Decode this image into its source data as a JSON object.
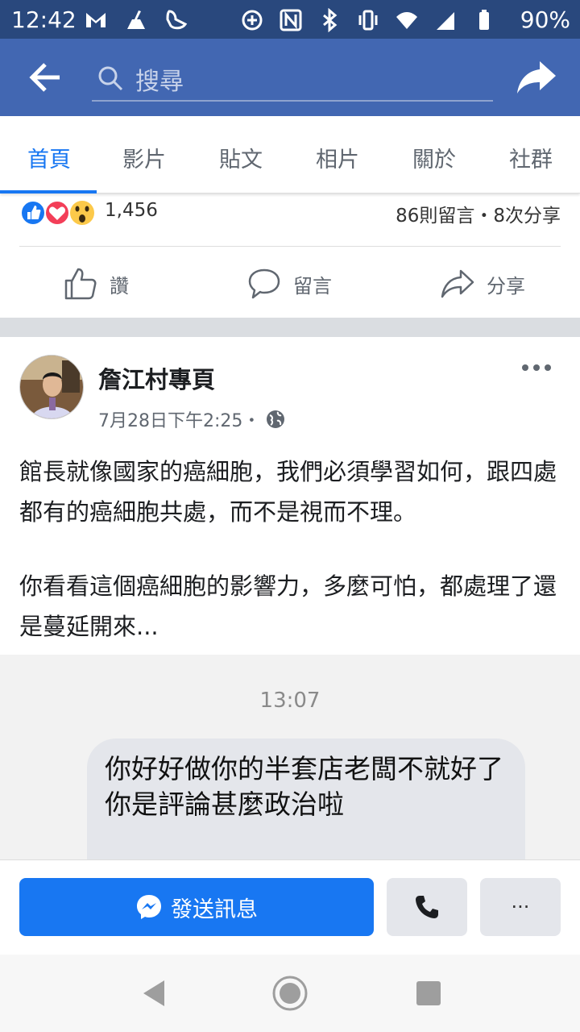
{
  "status_bar": {
    "time": "12:42",
    "battery": "90%",
    "left_icons": [
      "gmail-icon",
      "cleaner-icon",
      "pigeon-icon"
    ],
    "right_icons": [
      "add-circle-icon",
      "nfc-icon",
      "bluetooth-icon",
      "vibrate-icon",
      "wifi-icon",
      "signal-icon",
      "battery-icon"
    ]
  },
  "header": {
    "search_placeholder": "搜尋"
  },
  "tabs": [
    {
      "label": "首頁",
      "active": true
    },
    {
      "label": "影片",
      "active": false
    },
    {
      "label": "貼文",
      "active": false
    },
    {
      "label": "相片",
      "active": false
    },
    {
      "label": "關於",
      "active": false
    },
    {
      "label": "社群",
      "active": false
    }
  ],
  "reactions": {
    "icons": [
      "like-icon",
      "love-icon",
      "wow-icon"
    ],
    "count": "1,456",
    "summary": "86則留言・8次分享"
  },
  "actions": {
    "like": "讚",
    "comment": "留言",
    "share": "分享"
  },
  "post": {
    "author": "詹江村專頁",
    "time": "7月28日下午2:25・",
    "privacy_icon": "globe-icon",
    "paragraph1": "館長就像國家的癌細胞，我們必須學習如何，跟四處都有的癌細胞共處，而不是視而不理。",
    "paragraph2": "你看看這個癌細胞的影響力，多麼可怕，都處理了還是蔓延開來..."
  },
  "embedded_chat": {
    "time": "13:07",
    "message_line1": "你好好做你的半套店老闆不就好了",
    "message_line2": "你是評論甚麼政治啦"
  },
  "bottom_bar": {
    "send_label": "發送訊息",
    "more_label": "···"
  },
  "colors": {
    "header": "#4267b2",
    "status_bar": "#29487d",
    "accent": "#1877f2",
    "gray_button": "#e4e6eb"
  }
}
